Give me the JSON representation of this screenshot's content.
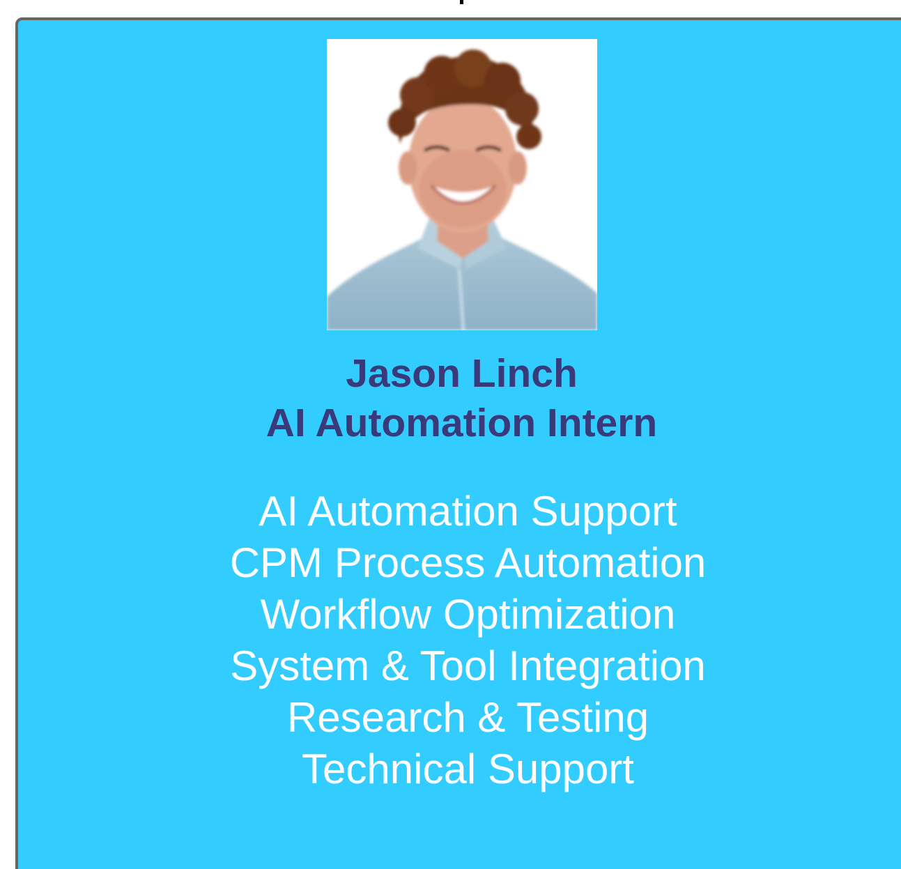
{
  "card": {
    "background_color": "#33ccff",
    "border_color": "#666666",
    "photo": {
      "icon": "profile-photo",
      "alt": "Jason Linch"
    },
    "name": "Jason Linch",
    "role": "AI Automation Intern",
    "text_color_title": "#3a3a7a",
    "text_color_duties": "#ffffff",
    "duties": [
      "AI Automation Support",
      "CPM Process Automation",
      "Workflow Optimization",
      "System & Tool Integration",
      "Research & Testing",
      "Technical Support"
    ]
  }
}
